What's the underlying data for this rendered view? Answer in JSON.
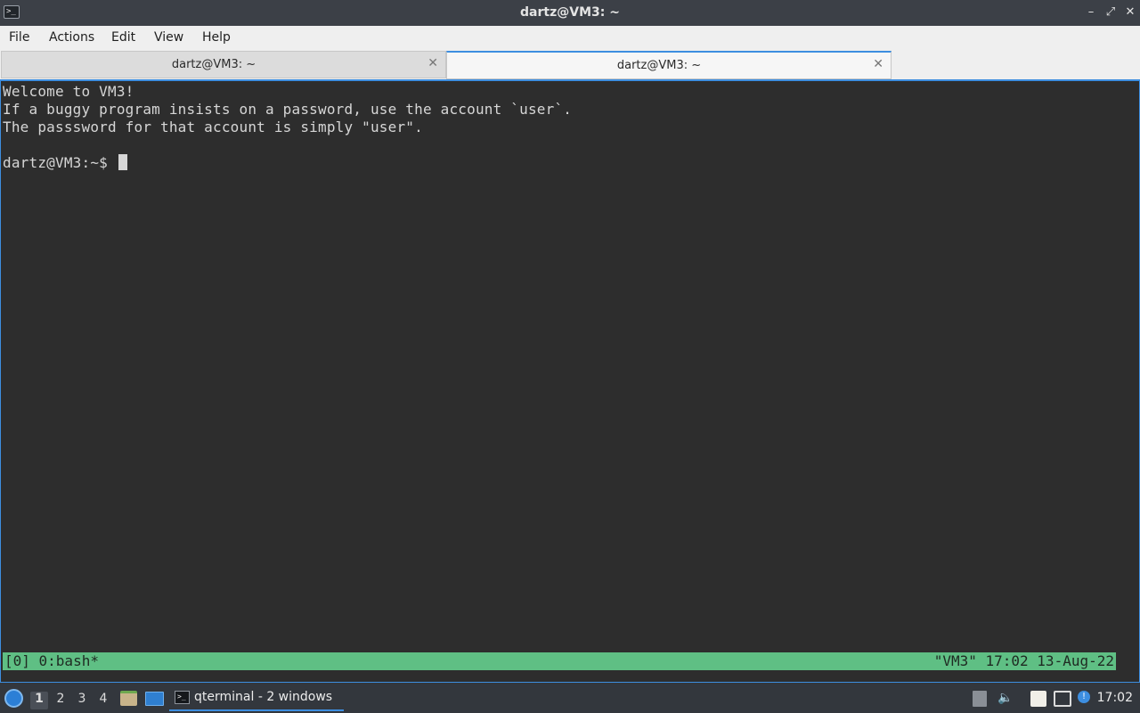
{
  "window": {
    "title": "dartz@VM3: ~",
    "controls": [
      "minimize",
      "restore",
      "close"
    ]
  },
  "menu": [
    "File",
    "Actions",
    "Edit",
    "View",
    "Help"
  ],
  "tabs": [
    {
      "label": "dartz@VM3: ~",
      "active": false
    },
    {
      "label": "dartz@VM3: ~",
      "active": true
    }
  ],
  "terminal": {
    "lines": [
      "Welcome to VM3!",
      "If a buggy program insists on a password, use the account `user`.",
      "The passsword for that account is simply \"user\".",
      "",
      "dartz@VM3:~$ "
    ]
  },
  "tmux_status": {
    "left": "[0] 0:bash*",
    "right": "\"VM3\" 17:02 13-Aug-22",
    "color": "#5fbf84"
  },
  "taskbar": {
    "workspaces": [
      "1",
      "2",
      "3",
      "4"
    ],
    "active_workspace": "1",
    "task_label": "qterminal - 2 windows",
    "clock": "17:02"
  },
  "colors": {
    "accent": "#3d8ee0",
    "terminal_bg": "#2d2d2d",
    "terminal_fg": "#d6d6d6"
  }
}
